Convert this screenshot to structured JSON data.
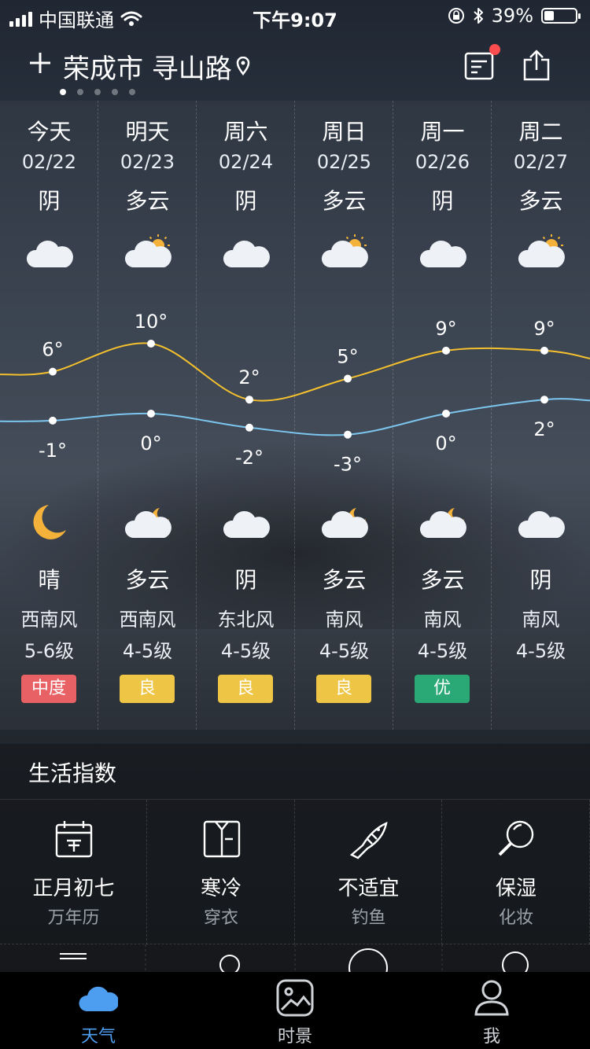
{
  "status_bar": {
    "carrier": "中国联通",
    "time": "下午9:07",
    "battery": "39%",
    "battery_level": 0.39
  },
  "header": {
    "add_icon": "plus-icon",
    "location": "荣成市 寻山路",
    "pin_icon": "location-pin-icon",
    "news_icon": "news-icon",
    "share_icon": "share-icon",
    "page_count": 5,
    "active_page": 0
  },
  "forecast": [
    {
      "day": "今天",
      "date": "02/22",
      "day_condition": "阴",
      "day_icon": "cloud-icon",
      "high": "6°",
      "low": "-1°",
      "night_icon": "moon-icon",
      "night_condition": "晴",
      "wind_dir": "西南风",
      "wind_level": "5-6级",
      "aqi": "中度",
      "aqi_color": "#e86165"
    },
    {
      "day": "明天",
      "date": "02/23",
      "day_condition": "多云",
      "day_icon": "partly-sunny-icon",
      "high": "10°",
      "low": "0°",
      "night_icon": "cloud-moon-icon",
      "night_condition": "多云",
      "wind_dir": "西南风",
      "wind_level": "4-5级",
      "aqi": "良",
      "aqi_color": "#eec544"
    },
    {
      "day": "周六",
      "date": "02/24",
      "day_condition": "阴",
      "day_icon": "cloud-icon",
      "high": "2°",
      "low": "-2°",
      "night_icon": "cloud-icon",
      "night_condition": "阴",
      "wind_dir": "东北风",
      "wind_level": "4-5级",
      "aqi": "良",
      "aqi_color": "#eec544"
    },
    {
      "day": "周日",
      "date": "02/25",
      "day_condition": "多云",
      "day_icon": "partly-sunny-icon",
      "high": "5°",
      "low": "-3°",
      "night_icon": "cloud-moon-icon",
      "night_condition": "多云",
      "wind_dir": "南风",
      "wind_level": "4-5级",
      "aqi": "良",
      "aqi_color": "#eec544"
    },
    {
      "day": "周一",
      "date": "02/26",
      "day_condition": "阴",
      "day_icon": "cloud-icon",
      "high": "9°",
      "low": "0°",
      "night_icon": "cloud-moon-icon",
      "night_condition": "多云",
      "wind_dir": "南风",
      "wind_level": "4-5级",
      "aqi": "优",
      "aqi_color": "#2aa876"
    },
    {
      "day": "周二",
      "date": "02/27",
      "day_condition": "多云",
      "day_icon": "partly-sunny-icon",
      "high": "9°",
      "low": "2°",
      "night_icon": "cloud-icon",
      "night_condition": "阴",
      "wind_dir": "南风",
      "wind_level": "4-5级",
      "aqi": "",
      "aqi_color": ""
    }
  ],
  "chart_data": {
    "type": "line",
    "categories": [
      "今天",
      "明天",
      "周六",
      "周日",
      "周一",
      "周二"
    ],
    "series": [
      {
        "values": [
          6,
          10,
          2,
          5,
          9,
          9
        ],
        "color": "#f5c02e"
      },
      {
        "values": [
          -1,
          0,
          -2,
          -3,
          0,
          2
        ],
        "color": "#7cc5ee"
      }
    ]
  },
  "life_index": {
    "title": "生活指数",
    "items": [
      {
        "value": "正月初七",
        "label": "万年历",
        "icon": "calendar-icon"
      },
      {
        "value": "寒冷",
        "label": "穿衣",
        "icon": "shirt-icon"
      },
      {
        "value": "不适宜",
        "label": "钓鱼",
        "icon": "fish-icon"
      },
      {
        "value": "保湿",
        "label": "化妆",
        "icon": "magnifier-icon"
      }
    ]
  },
  "tabs": [
    {
      "label": "天气",
      "icon": "weather-cloud-icon",
      "active": true
    },
    {
      "label": "时景",
      "icon": "photo-icon",
      "active": false
    },
    {
      "label": "我",
      "icon": "person-icon",
      "active": false
    }
  ]
}
